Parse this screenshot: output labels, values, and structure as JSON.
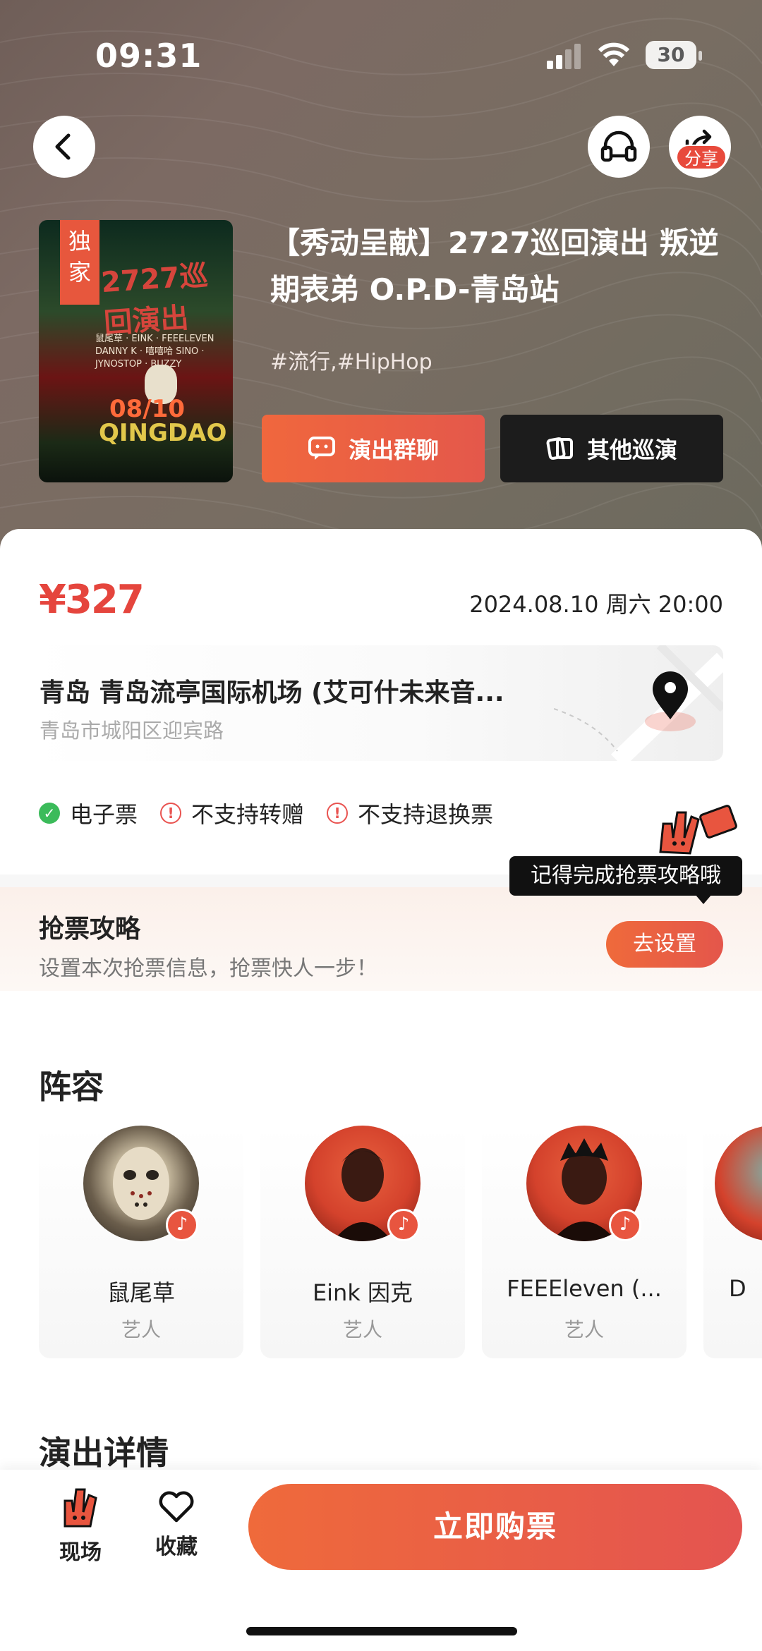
{
  "status_bar": {
    "time": "09:31",
    "battery": "30"
  },
  "header": {
    "share_label": "分享"
  },
  "event": {
    "poster_tag": "独家",
    "poster_title": "2727巡回演出",
    "poster_lines": "鼠尾草 · EINK · FEEELEVEN\nDANNY K · 嘻嘻哈 SINO · JYNOSTOP · BUZZY",
    "poster_date": "08/10",
    "poster_city": "QINGDAO",
    "title": "【秀动呈献】2727巡回演出 叛逆期表弟 O.P.D-青岛站",
    "tags": "#流行,#HipHop",
    "chat_button": "演出群聊",
    "tours_button": "其他巡演"
  },
  "details": {
    "price": "¥327",
    "datetime": "2024.08.10 周六 20:00",
    "venue_name": "青岛 青岛流亭国际机场 (艾可什未来音...",
    "venue_address": "青岛市城阳区迎宾路",
    "badges": [
      {
        "label": "电子票",
        "type": "ok"
      },
      {
        "label": "不支持转赠",
        "type": "warn"
      },
      {
        "label": "不支持退换票",
        "type": "warn"
      }
    ]
  },
  "strategy": {
    "tooltip": "记得完成抢票攻略哦",
    "title": "抢票攻略",
    "subtitle": "设置本次抢票信息，抢票快人一步！",
    "button": "去设置"
  },
  "lineup": {
    "title": "阵容",
    "artists": [
      {
        "name": "鼠尾草",
        "role": "艺人"
      },
      {
        "name": "Eink 因克",
        "role": "艺人"
      },
      {
        "name": "FEEEleven (...",
        "role": "艺人"
      },
      {
        "name": "D",
        "role": ""
      }
    ]
  },
  "details_section": {
    "title": "演出详情"
  },
  "bottom_bar": {
    "live_label": "现场",
    "fav_label": "收藏",
    "buy_label": "立即购票"
  },
  "colors": {
    "accent": "#e8553f",
    "price": "#e5453d",
    "dark_button": "#1c1c1c"
  }
}
